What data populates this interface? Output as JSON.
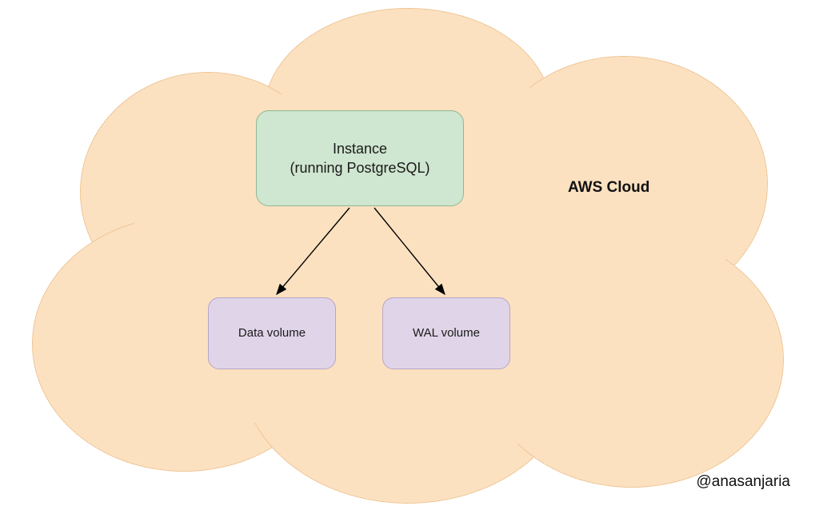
{
  "diagram": {
    "cloud_label": "AWS Cloud",
    "instance": {
      "line1": "Instance",
      "line2": "(running PostgreSQL)"
    },
    "volumes": {
      "data": "Data volume",
      "wal": "WAL volume"
    },
    "attribution": "@anasanjaria"
  },
  "chart_data": {
    "type": "diagram",
    "nodes": [
      {
        "id": "instance",
        "label": "Instance (running PostgreSQL)",
        "kind": "compute"
      },
      {
        "id": "data_volume",
        "label": "Data volume",
        "kind": "storage"
      },
      {
        "id": "wal_volume",
        "label": "WAL volume",
        "kind": "storage"
      }
    ],
    "edges": [
      {
        "from": "instance",
        "to": "data_volume",
        "directed": true
      },
      {
        "from": "instance",
        "to": "wal_volume",
        "directed": true
      }
    ],
    "container": {
      "id": "aws_cloud",
      "label": "AWS Cloud",
      "contains": [
        "instance",
        "data_volume",
        "wal_volume"
      ]
    }
  },
  "colors": {
    "cloud_fill": "#fce1c1",
    "cloud_border": "#e0a968",
    "instance_fill": "#cfe6d0",
    "instance_border": "#8fb893",
    "volume_fill": "#e0d5e8",
    "volume_border": "#b7a5c6"
  }
}
